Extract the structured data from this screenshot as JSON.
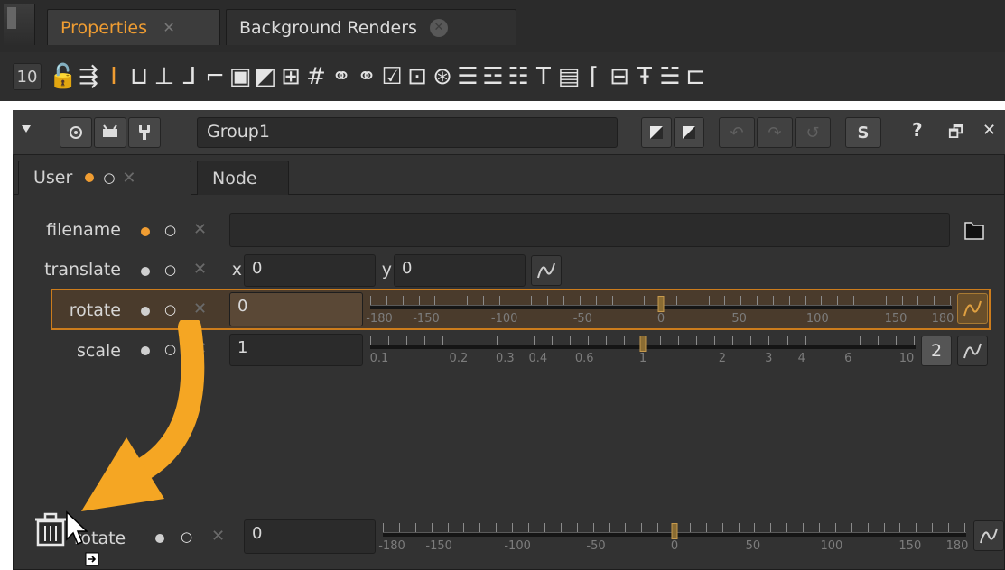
{
  "tabs": [
    {
      "label": "Properties",
      "close": "✕",
      "active": true
    },
    {
      "label": "Background Renders",
      "close": "✕",
      "active": false
    }
  ],
  "toolbar": {
    "count": "10",
    "icons": [
      {
        "name": "lock-icon",
        "glyph": "🔓"
      },
      {
        "name": "clear-panels-icon",
        "glyph": "⇶"
      },
      {
        "name": "int-knob-icon",
        "glyph": "I"
      },
      {
        "name": "xy-knob-icon",
        "glyph": "⊔"
      },
      {
        "name": "xyz-knob-icon",
        "glyph": "⊥"
      },
      {
        "name": "3d-axis-icon",
        "glyph": "⅃"
      },
      {
        "name": "wh-knob-icon",
        "glyph": "⌐"
      },
      {
        "name": "bbox-knob-icon",
        "glyph": "▣"
      },
      {
        "name": "size-knob-icon",
        "glyph": "◩"
      },
      {
        "name": "uv-knob-icon",
        "glyph": "⊞"
      },
      {
        "name": "hash-icon",
        "glyph": "#"
      },
      {
        "name": "color-rgb-icon",
        "glyph": "⚭"
      },
      {
        "name": "color-rgba-icon",
        "glyph": "⚭"
      },
      {
        "name": "checkbox-knob-icon",
        "glyph": "☑"
      },
      {
        "name": "pulldown-icon",
        "glyph": "⊡"
      },
      {
        "name": "python-button-icon",
        "glyph": "⊛"
      },
      {
        "name": "text-input-icon",
        "glyph": "☰"
      },
      {
        "name": "multiline-icon",
        "glyph": "☲"
      },
      {
        "name": "list-icon",
        "glyph": "☷"
      },
      {
        "name": "text-label-icon",
        "glyph": "T"
      },
      {
        "name": "file-knob-icon",
        "glyph": "▤"
      },
      {
        "name": "tab-icon",
        "glyph": "⌈"
      },
      {
        "name": "group-icon",
        "glyph": "⊟"
      },
      {
        "name": "divider-icon",
        "glyph": "Ŧ"
      },
      {
        "name": "separator-icon",
        "glyph": "☱"
      },
      {
        "name": "link-icon",
        "glyph": "⊏"
      }
    ]
  },
  "panel": {
    "node_name": "Group1",
    "tabs": [
      {
        "label": "User",
        "active": true
      },
      {
        "label": "Node",
        "active": false
      }
    ],
    "header_buttons": {
      "help": "?",
      "float": "🗗",
      "close": "✕",
      "s": "S"
    }
  },
  "knobs": {
    "filename": {
      "label": "filename"
    },
    "translate": {
      "label": "translate",
      "x_label": "x",
      "x_value": "0",
      "y_label": "y",
      "y_value": "0"
    },
    "rotate": {
      "label": "rotate",
      "value": "0",
      "slider_labels": [
        "-180",
        "-150",
        "-100",
        "-50",
        "0",
        "50",
        "100",
        "150",
        "180"
      ],
      "slider_value": 0
    },
    "scale": {
      "label": "scale",
      "value": "1",
      "slider_labels": [
        "0.1",
        "0.2",
        "0.3",
        "0.4",
        "0.6",
        "1",
        "2",
        "3",
        "4",
        "6",
        "10"
      ],
      "slider_value": 1,
      "multi_button": "2"
    }
  },
  "drag_ghost": {
    "label": "rotate",
    "value": "0",
    "slider_labels": [
      "-180",
      "-150",
      "-100",
      "-50",
      "0",
      "50",
      "100",
      "150",
      "180"
    ]
  },
  "colors": {
    "accent": "#f09d32",
    "arrow": "#f5a623"
  }
}
